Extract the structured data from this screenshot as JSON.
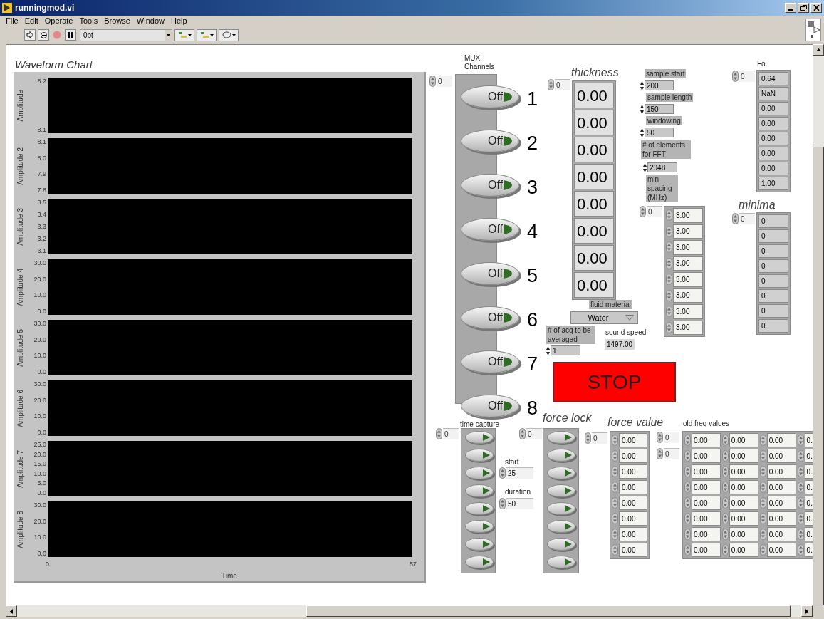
{
  "window": {
    "title": "runningmod.vi"
  },
  "menu": [
    "File",
    "Edit",
    "Operate",
    "Tools",
    "Browse",
    "Window",
    "Help"
  ],
  "toolbar": {
    "font": "0pt"
  },
  "chart": {
    "title": "Waveform Chart",
    "xlabel": "Time",
    "xticks": [
      "0",
      "57"
    ],
    "plots": [
      {
        "ylabel": "Amplitude",
        "yticks": [
          "8.2",
          "8.1"
        ]
      },
      {
        "ylabel": "Amplitude 2",
        "yticks": [
          "8.1",
          "8.0",
          "7.9",
          "7.8"
        ]
      },
      {
        "ylabel": "Amplitude 3",
        "yticks": [
          "3.5",
          "3.4",
          "3.3",
          "3.2",
          "3.1"
        ]
      },
      {
        "ylabel": "Amplitude 4",
        "yticks": [
          "30.0",
          "20.0",
          "10.0",
          "0.0"
        ]
      },
      {
        "ylabel": "Amplitude 5",
        "yticks": [
          "30.0",
          "20.0",
          "10.0",
          "0.0"
        ]
      },
      {
        "ylabel": "Amplitude 6",
        "yticks": [
          "30.0",
          "20.0",
          "10.0",
          "0.0"
        ]
      },
      {
        "ylabel": "Amplitude 7",
        "yticks": [
          "25.0",
          "20.0",
          "15.0",
          "10.0",
          "5.0",
          "0.0"
        ]
      },
      {
        "ylabel": "Amplitude 8",
        "yticks": [
          "30.0",
          "20.0",
          "10.0",
          "0.0"
        ]
      }
    ]
  },
  "mux": {
    "label": "MUX Channels",
    "index": "0",
    "buttons": [
      {
        "text": "Off",
        "number": "1",
        "on": false
      },
      {
        "text": "Off",
        "number": "2",
        "on": false
      },
      {
        "text": "Off",
        "number": "3",
        "on": false
      },
      {
        "text": "Off",
        "number": "4",
        "on": false
      },
      {
        "text": "Off",
        "number": "5",
        "on": false
      },
      {
        "text": "Off",
        "number": "6",
        "on": false
      },
      {
        "text": "Off",
        "number": "7",
        "on": false
      },
      {
        "text": "Off",
        "number": "8",
        "on": false
      }
    ]
  },
  "thickness": {
    "label": "thickness",
    "index": "0",
    "values": [
      "0.00",
      "0.00",
      "0.00",
      "0.00",
      "0.00",
      "0.00",
      "0.00",
      "0.00"
    ]
  },
  "sample_start": {
    "label": "sample start",
    "value": "200"
  },
  "sample_length": {
    "label": "sample length",
    "value": "150"
  },
  "windowing": {
    "label": "windowing",
    "value": "50"
  },
  "fft_elements": {
    "label": "# of elements for FFT",
    "value": "2048"
  },
  "min_spacing": {
    "label": "min spacing (MHz)",
    "index": "0",
    "values": [
      "3.00",
      "3.00",
      "3.00",
      "3.00",
      "3.00",
      "3.00",
      "3.00",
      "3.00"
    ]
  },
  "fo": {
    "label": "Fo",
    "index": "0",
    "values": [
      "0.64",
      "NaN",
      "0.00",
      "0.00",
      "0.00",
      "0.00",
      "0.00",
      "1.00"
    ]
  },
  "minima": {
    "label": "minima",
    "index": "0",
    "values": [
      "0",
      "0",
      "0",
      "0",
      "0",
      "0",
      "0",
      "0"
    ]
  },
  "fluid_material": {
    "label": "fluid material",
    "value": "Water"
  },
  "acq_averaged": {
    "label": "# of acq to be averaged",
    "value": "1"
  },
  "sound_speed": {
    "label": "sound speed",
    "value": "1497.00"
  },
  "stop": {
    "label": "STOP"
  },
  "time_capture": {
    "label": "time capture",
    "index": "0",
    "switches": [
      {
        "on": false
      },
      {
        "on": false
      },
      {
        "on": false
      },
      {
        "on": false
      },
      {
        "on": false
      },
      {
        "on": false
      },
      {
        "on": false
      },
      {
        "on": false
      }
    ]
  },
  "start": {
    "label": "start",
    "value": "25"
  },
  "duration": {
    "label": "duration",
    "value": "50"
  },
  "force_lock": {
    "label": "force lock",
    "index": "0",
    "switches": [
      {
        "on": false
      },
      {
        "on": false
      },
      {
        "on": false
      },
      {
        "on": false
      },
      {
        "on": false
      },
      {
        "on": false
      },
      {
        "on": false
      },
      {
        "on": false
      }
    ]
  },
  "force_value": {
    "label": "force value",
    "index": "0",
    "values": [
      "0.00",
      "0.00",
      "0.00",
      "0.00",
      "0.00",
      "0.00",
      "0.00",
      "0.00"
    ]
  },
  "old_freq": {
    "label": "old freq values",
    "indices": [
      "0",
      "0"
    ],
    "rows": [
      [
        "0.00",
        "0.00",
        "0.00",
        "0."
      ],
      [
        "0.00",
        "0.00",
        "0.00",
        "0."
      ],
      [
        "0.00",
        "0.00",
        "0.00",
        "0."
      ],
      [
        "0.00",
        "0.00",
        "0.00",
        "0."
      ],
      [
        "0.00",
        "0.00",
        "0.00",
        "0."
      ],
      [
        "0.00",
        "0.00",
        "0.00",
        "0."
      ],
      [
        "0.00",
        "0.00",
        "0.00",
        "0."
      ],
      [
        "0.00",
        "0.00",
        "0.00",
        "0."
      ]
    ]
  }
}
